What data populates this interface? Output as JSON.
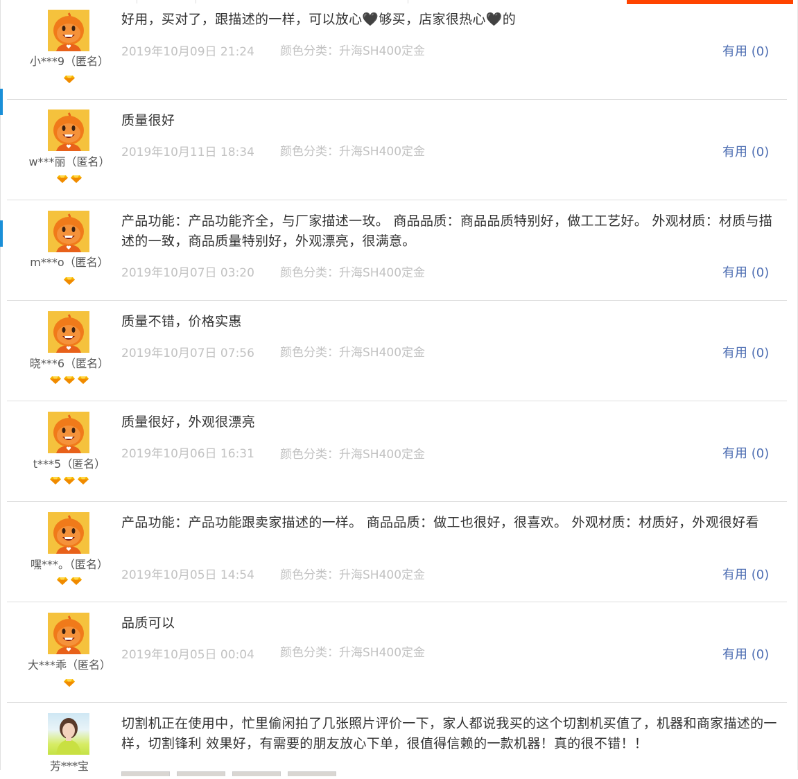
{
  "colors": {
    "accent": "#ff4400",
    "link": "#4f6fb3",
    "meta": "#c2c2c2",
    "divider": "#dedede"
  },
  "reviews": [
    {
      "user": "小***9",
      "anon": "（匿名）",
      "level": 1,
      "avatar": "taobao-doll",
      "text": "好用，买对了，跟描述的一样，可以放心🖤够买，店家很热心🖤的",
      "date": "2019年10月09日 21:24",
      "sku": "颜色分类：升海SH400定金",
      "useful": "有用 (0)"
    },
    {
      "user": "w***丽",
      "anon": "（匿名）",
      "level": 2,
      "avatar": "taobao-doll",
      "text": "质量很好",
      "date": "2019年10月11日 18:34",
      "sku": "颜色分类：升海SH400定金",
      "useful": "有用 (0)"
    },
    {
      "user": "m***o",
      "anon": "（匿名）",
      "level": 1,
      "avatar": "taobao-doll",
      "text": "产品功能：产品功能齐全，与厂家描述一玫。 商品品质：商品品质特别好，做工工艺好。 外观材质：材质与描述的一致，商品质量特别好，外观漂亮，很满意。",
      "date": "2019年10月07日 03:20",
      "sku": "颜色分类：升海SH400定金",
      "useful": "有用 (0)"
    },
    {
      "user": "晓***6",
      "anon": "（匿名）",
      "level": 3,
      "avatar": "taobao-doll",
      "text": "质量不错，价格实惠",
      "date": "2019年10月07日 07:56",
      "sku": "颜色分类：升海SH400定金",
      "useful": "有用 (0)"
    },
    {
      "user": "t***5",
      "anon": "（匿名）",
      "level": 3,
      "avatar": "taobao-doll",
      "text": "质量很好，外观很漂亮",
      "date": "2019年10月06日 16:31",
      "sku": "颜色分类：升海SH400定金",
      "useful": "有用 (0)"
    },
    {
      "user": "嘿***。",
      "anon": "（匿名）",
      "level": 2,
      "avatar": "taobao-doll",
      "text": "产品功能：产品功能跟卖家描述的一样。 商品品质：做工也很好，很喜欢。 外观材质：材质好，外观很好看",
      "date": "2019年10月05日 14:54",
      "sku": "颜色分类：升海SH400定金",
      "useful": "有用 (0)"
    },
    {
      "user": "大***乖",
      "anon": "（匿名）",
      "level": 1,
      "avatar": "taobao-doll",
      "text": "品质可以",
      "date": "2019年10月05日 00:04",
      "sku": "颜色分类：升海SH400定金",
      "useful": "有用 (0)"
    },
    {
      "user": "芳***宝",
      "anon": "",
      "level": 0,
      "avatar": "user-photo",
      "text": "切割机正在使用中，忙里偷闲拍了几张照片评价一下，家人都说我买的这个切割机买值了，机器和商家描述的一样，切割锋利 效果好，有需要的朋友放心下单，很值得信赖的一款机器！真的很不错！！",
      "date": "",
      "sku": "",
      "useful": ""
    }
  ]
}
